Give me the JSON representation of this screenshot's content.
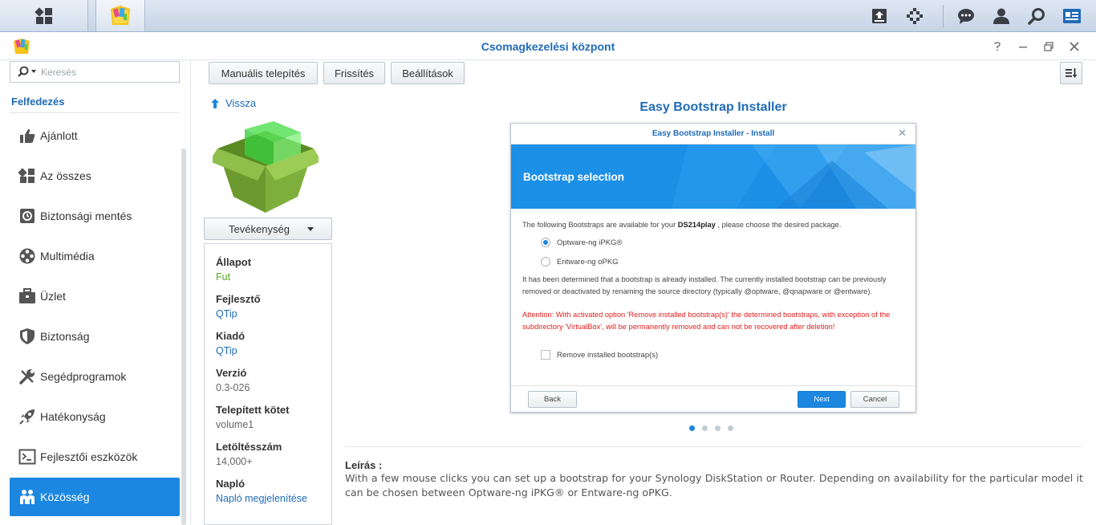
{
  "window": {
    "title": "Csomagkezelési központ"
  },
  "search": {
    "placeholder": "Keresés"
  },
  "sidebar": {
    "section_heading": "Felfedezés",
    "items": [
      {
        "label": "Ajánlott",
        "icon": "thumbs-up-icon"
      },
      {
        "label": "Az összes",
        "icon": "grid-icon"
      },
      {
        "label": "Biztonsági mentés",
        "icon": "backup-icon"
      },
      {
        "label": "Multimédia",
        "icon": "film-reel-icon"
      },
      {
        "label": "Üzlet",
        "icon": "briefcase-icon"
      },
      {
        "label": "Biztonság",
        "icon": "shield-icon"
      },
      {
        "label": "Segédprogramok",
        "icon": "tools-icon"
      },
      {
        "label": "Hatékonyság",
        "icon": "rocket-icon"
      },
      {
        "label": "Fejlesztői eszközök",
        "icon": "terminal-icon"
      },
      {
        "label": "Közösség",
        "icon": "community-icon"
      }
    ],
    "active_index": 9
  },
  "toolbar": {
    "manual_install": "Manuális telepítés",
    "refresh": "Frissítés",
    "settings": "Beállítások"
  },
  "detail": {
    "back_label": "Vissza",
    "action_label": "Tevékenység",
    "fields": [
      {
        "key": "Állapot",
        "value": "Fut"
      },
      {
        "key": "Fejlesztő",
        "value": "QTip"
      },
      {
        "key": "Kiadó",
        "value": "QTip"
      },
      {
        "key": "Verzió",
        "value": "0.3-026"
      },
      {
        "key": "Telepített kötet",
        "value": "volume1"
      },
      {
        "key": "Letöltésszám",
        "value": "14,000+"
      },
      {
        "key": "Napló",
        "value": "Napló megjelenítése"
      }
    ],
    "package_title": "Easy Bootstrap Installer",
    "description_label": "Leírás :",
    "description": "With a few mouse clicks you can set up a bootstrap for your Synology DiskStation or Router. Depending on availability for the particular model it can be chosen between Optware-ng iPKG® or Entware-ng oPKG."
  },
  "screenshot": {
    "title": "Easy Bootstrap Installer - Install",
    "heading": "Bootstrap selection",
    "intro_before": "The following Bootstraps are available for your ",
    "intro_model": "DS214play",
    "intro_after": " , please choose the desired package.",
    "options": [
      "Optware-ng iPKG®",
      "Entware-ng oPKG"
    ],
    "selected_option": 0,
    "info": "It has been determined that a bootstrap is already installed. The currently installed bootstrap can be previously removed or deactivated by renaming the source directory (typically @optware, @qnapware or @entware).",
    "warning": "Attention: With activated option 'Remove installed bootstrap(s)' the determined bootstraps, with exception of the subdirectory 'VirtualBox', will be permanently removed and can not be recovered after deletion!",
    "checkbox_label": "Remove installed bootstrap(s)",
    "back_btn": "Back",
    "next_btn": "Next",
    "cancel_btn": "Cancel",
    "page_count": 4,
    "current_page": 0
  },
  "colors": {
    "accent": "#1b87e0",
    "title": "#1f6bb8",
    "status_running": "#54a825",
    "warning": "#e02020"
  }
}
